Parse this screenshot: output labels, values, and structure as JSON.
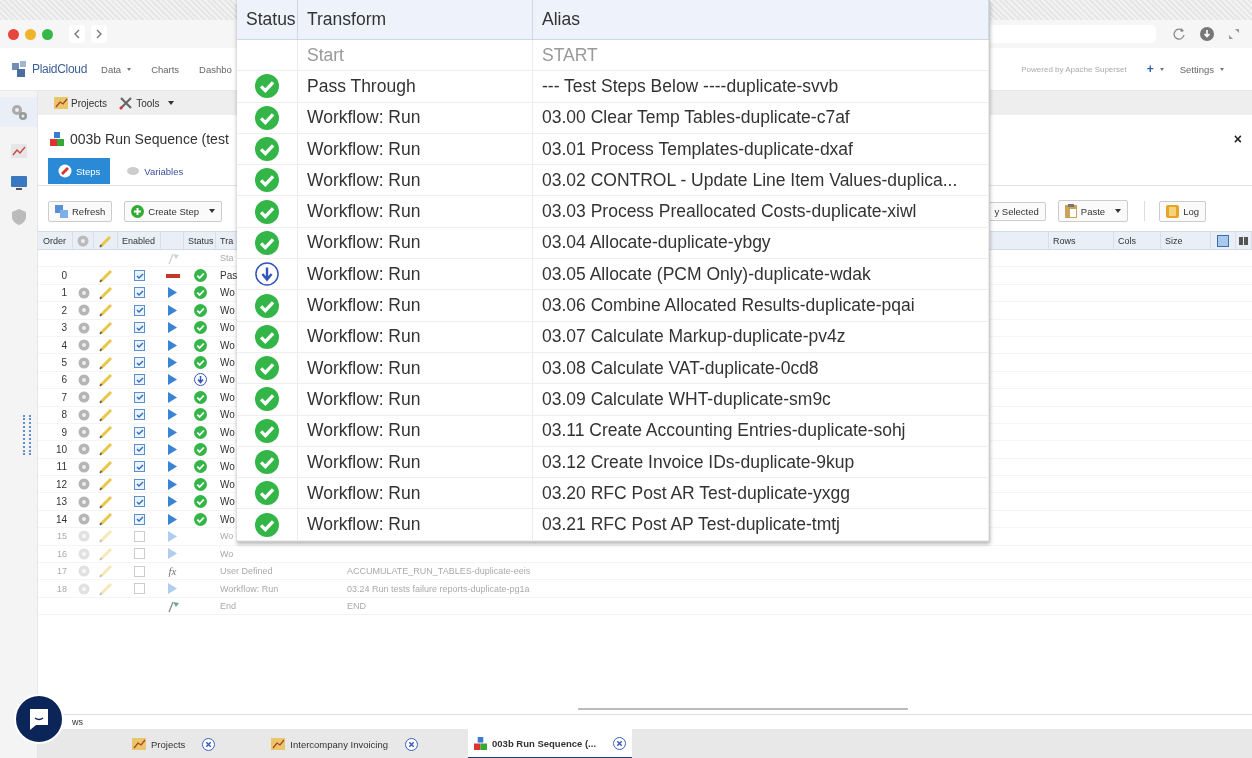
{
  "nav": {
    "logo": "PlaidCloud",
    "menu": [
      {
        "label": "Data",
        "dropdown": true
      },
      {
        "label": "Charts",
        "dropdown": false
      },
      {
        "label": "Dashbo",
        "dropdown": false
      }
    ],
    "powered_by": "Powered by Apache Superset",
    "add": "+",
    "settings": "Settings"
  },
  "toolbar": [
    {
      "label": "Projects",
      "dropdown": false
    },
    {
      "label": "Tools",
      "dropdown": true
    }
  ],
  "document": {
    "title": "003b Run Sequence (test",
    "close": "×"
  },
  "tabs": [
    {
      "label": "Steps",
      "selected": true
    },
    {
      "label": "Variables",
      "selected": false
    }
  ],
  "actions_left": [
    {
      "label": "Refresh",
      "dropdown": false
    },
    {
      "label": "Create Step",
      "dropdown": true
    }
  ],
  "actions_right": [
    {
      "label": "y Selected",
      "dropdown": false
    },
    {
      "label": "Paste",
      "dropdown": true
    },
    {
      "label": "Log",
      "dropdown": false
    }
  ],
  "steps": {
    "columns": {
      "order": "Order",
      "enabled": "Enabled",
      "status": "Status",
      "transform": "Tra",
      "rows": "Rows",
      "cols": "Cols",
      "size": "Size"
    },
    "rows": [
      {
        "kind": "start",
        "transform": "Sta"
      },
      {
        "kind": "pass",
        "order": "0",
        "enabled": true,
        "done": true,
        "waiting": false,
        "transform": "Pas"
      },
      {
        "kind": "workflow",
        "order": "1",
        "enabled": true,
        "done": true,
        "waiting": false,
        "transform": "Wo"
      },
      {
        "kind": "workflow",
        "order": "2",
        "enabled": true,
        "done": true,
        "waiting": false,
        "transform": "Wo"
      },
      {
        "kind": "workflow",
        "order": "3",
        "enabled": true,
        "done": true,
        "waiting": false,
        "transform": "Wo"
      },
      {
        "kind": "workflow",
        "order": "4",
        "enabled": true,
        "done": true,
        "waiting": false,
        "transform": "Wo"
      },
      {
        "kind": "workflow",
        "order": "5",
        "enabled": true,
        "done": true,
        "waiting": false,
        "transform": "Wo"
      },
      {
        "kind": "workflow",
        "order": "6",
        "enabled": true,
        "done": false,
        "waiting": true,
        "transform": "Wo"
      },
      {
        "kind": "workflow",
        "order": "7",
        "enabled": true,
        "done": true,
        "waiting": false,
        "transform": "Wo"
      },
      {
        "kind": "workflow",
        "order": "8",
        "enabled": true,
        "done": true,
        "waiting": false,
        "transform": "Wo"
      },
      {
        "kind": "workflow",
        "order": "9",
        "enabled": true,
        "done": true,
        "waiting": false,
        "transform": "Wo"
      },
      {
        "kind": "workflow",
        "order": "10",
        "enabled": true,
        "done": true,
        "waiting": false,
        "transform": "Wo"
      },
      {
        "kind": "workflow",
        "order": "11",
        "enabled": true,
        "done": true,
        "waiting": false,
        "transform": "Wo"
      },
      {
        "kind": "workflow",
        "order": "12",
        "enabled": true,
        "done": true,
        "waiting": false,
        "transform": "Wo"
      },
      {
        "kind": "workflow",
        "order": "13",
        "enabled": true,
        "done": true,
        "waiting": false,
        "transform": "Wo"
      },
      {
        "kind": "workflow",
        "order": "14",
        "enabled": true,
        "done": true,
        "waiting": false,
        "transform": "Wo"
      },
      {
        "kind": "workflow",
        "order": "15",
        "enabled": false,
        "done": false,
        "waiting": false,
        "transform": "Wo"
      },
      {
        "kind": "workflow",
        "order": "16",
        "enabled": false,
        "done": false,
        "waiting": false,
        "transform": "Wo"
      },
      {
        "kind": "user",
        "order": "17",
        "enabled": false,
        "done": false,
        "waiting": false,
        "glyph": "fx",
        "transform": "User Defined",
        "alias": "ACCUMULATE_RUN_TABLES-duplicate-eeis"
      },
      {
        "kind": "workflow",
        "order": "18",
        "enabled": false,
        "done": false,
        "waiting": false,
        "transform": "Workflow: Run",
        "alias": "03.24 Run tests failure reports-duplicate-pg1a"
      },
      {
        "kind": "end",
        "transform": "End",
        "alias": "END"
      }
    ]
  },
  "footer": {
    "label": "ws"
  },
  "bottom_tabs": [
    {
      "label": "Projects",
      "selected": false
    },
    {
      "label": "Intercompany Invoicing",
      "selected": false
    },
    {
      "label": "003b Run Sequence (...",
      "selected": true
    }
  ],
  "zoom_view": {
    "columns": [
      "Status",
      "Transform",
      "Alias"
    ],
    "rows": [
      {
        "done": false,
        "waiting": false,
        "transform": "Start",
        "alias": "START"
      },
      {
        "done": true,
        "waiting": false,
        "transform": "Pass Through",
        "alias": "--- Test Steps Below ----duplicate-svvb"
      },
      {
        "done": true,
        "waiting": false,
        "transform": "Workflow: Run",
        "alias": "03.00 Clear Temp Tables-duplicate-c7af"
      },
      {
        "done": true,
        "waiting": false,
        "transform": "Workflow: Run",
        "alias": "03.01 Process Templates-duplicate-dxaf"
      },
      {
        "done": true,
        "waiting": false,
        "transform": "Workflow: Run",
        "alias": "03.02 CONTROL - Update Line Item Values-duplica..."
      },
      {
        "done": true,
        "waiting": false,
        "transform": "Workflow: Run",
        "alias": "03.03 Process Preallocated Costs-duplicate-xiwl"
      },
      {
        "done": true,
        "waiting": false,
        "transform": "Workflow: Run",
        "alias": "03.04 Allocate-duplicate-ybgy"
      },
      {
        "done": false,
        "waiting": true,
        "transform": "Workflow: Run",
        "alias": "03.05 Allocate (PCM Only)-duplicate-wdak"
      },
      {
        "done": true,
        "waiting": false,
        "transform": "Workflow: Run",
        "alias": "03.06 Combine Allocated Results-duplicate-pqai"
      },
      {
        "done": true,
        "waiting": false,
        "transform": "Workflow: Run",
        "alias": "03.07 Calculate Markup-duplicate-pv4z"
      },
      {
        "done": true,
        "waiting": false,
        "transform": "Workflow: Run",
        "alias": "03.08 Calculate VAT-duplicate-0cd8"
      },
      {
        "done": true,
        "waiting": false,
        "transform": "Workflow: Run",
        "alias": "03.09 Calculate WHT-duplicate-sm9c"
      },
      {
        "done": true,
        "waiting": false,
        "transform": "Workflow: Run",
        "alias": "03.11 Create Accounting Entries-duplicate-sohj"
      },
      {
        "done": true,
        "waiting": false,
        "transform": "Workflow: Run",
        "alias": "03.12 Create Invoice IDs-duplicate-9kup"
      },
      {
        "done": true,
        "waiting": false,
        "transform": "Workflow: Run",
        "alias": "03.20 RFC Post AR Test-duplicate-yxgg"
      },
      {
        "done": true,
        "waiting": false,
        "transform": "Workflow: Run",
        "alias": "03.21 RFC Post AP Test-duplicate-tmtj"
      }
    ]
  }
}
